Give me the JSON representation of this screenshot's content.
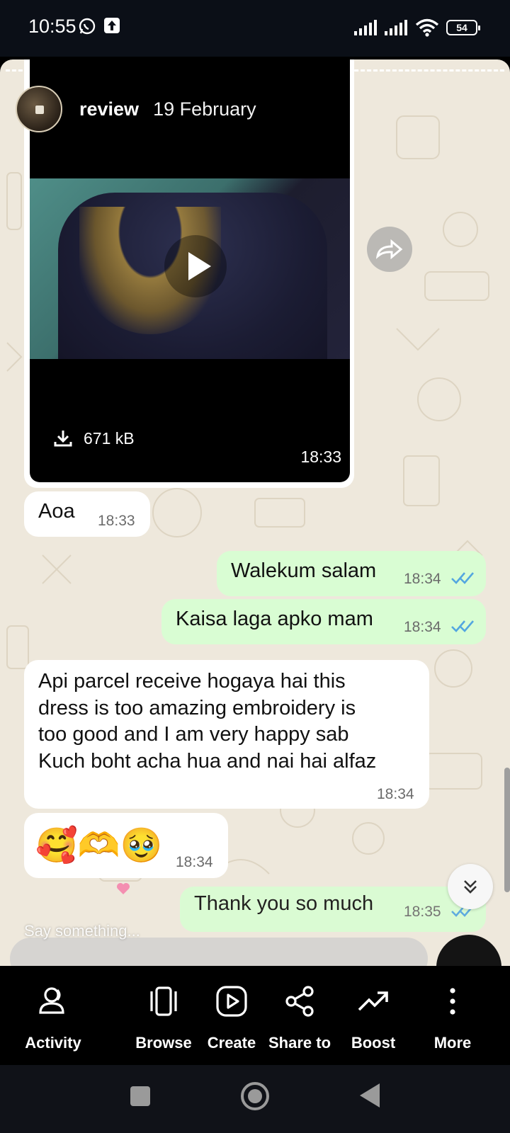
{
  "status_bar": {
    "time": "10:55",
    "battery": "54",
    "icons": [
      "whatsapp-icon",
      "upload-icon",
      "signal-icon",
      "signal-icon",
      "wifi-icon",
      "battery-icon"
    ]
  },
  "story": {
    "username": "review",
    "date": "19 February"
  },
  "video_message": {
    "size": "671 kB",
    "time": "18:33"
  },
  "messages": [
    {
      "from": "them",
      "text": "Aoa",
      "time": "18:33"
    },
    {
      "from": "me",
      "text": "Walekum salam",
      "time": "18:34",
      "status": "read"
    },
    {
      "from": "me",
      "text": "Kaisa laga apko mam",
      "time": "18:34",
      "status": "read"
    },
    {
      "from": "them",
      "lines": [
        "Api parcel receive hogaya hai this",
        "dress is too amazing embroidery is",
        "too good and I am very happy sab",
        "Kuch boht acha hua and  nai hai alfaz"
      ],
      "time": "18:34"
    },
    {
      "from": "them",
      "text": "🥰🫶🥹",
      "time": "18:34"
    },
    {
      "from": "me",
      "text": "Thank you so much",
      "time": "18:35",
      "status": "read"
    }
  ],
  "composer": {
    "placeholder": "Say something..."
  },
  "actions": [
    {
      "label": "Activity",
      "icon": "activity-icon"
    },
    {
      "label": "Browse",
      "icon": "browse-icon"
    },
    {
      "label": "Create",
      "icon": "create-icon"
    },
    {
      "label": "Share to",
      "icon": "share-icon"
    },
    {
      "label": "Boost",
      "icon": "boost-icon"
    },
    {
      "label": "More",
      "icon": "more-icon"
    }
  ],
  "colors": {
    "outgoing_bubble": "#d9fdd3",
    "incoming_bubble": "#ffffff",
    "read_ticks": "#53a6e0",
    "chat_wallpaper": "#eee8dc"
  }
}
